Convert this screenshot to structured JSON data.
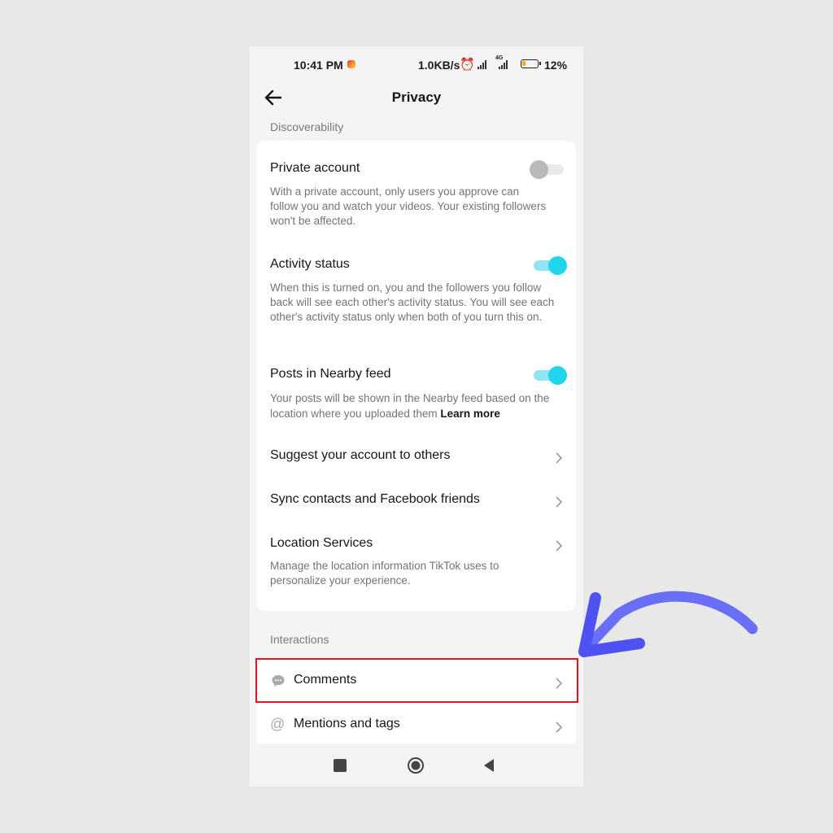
{
  "status_bar": {
    "time": "10:41 PM",
    "net_speed": "1.0KB/s",
    "network": "4G",
    "battery": "12%",
    "battery_level": 0.12
  },
  "header": {
    "title": "Privacy",
    "back_icon": "arrow-left-icon"
  },
  "sections": {
    "discoverability": "Discoverability",
    "interactions": "Interactions"
  },
  "discoverability_items": {
    "private_account": {
      "title": "Private account",
      "desc": "With a private account, only users you approve can follow you and watch your videos. Your existing followers won't be affected.",
      "enabled": false
    },
    "activity_status": {
      "title": "Activity status",
      "desc": "When this is turned on, you and the followers you follow back will see each other's activity status. You will see each other's activity status only when both of you turn this on.",
      "enabled": true
    },
    "nearby_feed": {
      "title": "Posts in Nearby feed",
      "desc": "Your posts will be shown in the Nearby feed based on the location where you uploaded them",
      "link": "Learn more",
      "enabled": true
    },
    "suggest": {
      "title": "Suggest your account to others"
    },
    "sync": {
      "title": "Sync contacts and Facebook friends"
    },
    "location": {
      "title": "Location Services",
      "desc": "Manage the location information TikTok uses to personalize your experience."
    }
  },
  "interaction_items": {
    "comments": {
      "title": "Comments",
      "icon": "comment-bubble-icon"
    },
    "mentions": {
      "title": "Mentions and tags",
      "icon": "at-sign-icon"
    }
  },
  "colors": {
    "accent": "#20d5ec",
    "highlight_box": "#e0151f",
    "annotation_arrow": "#5b5ef6"
  }
}
